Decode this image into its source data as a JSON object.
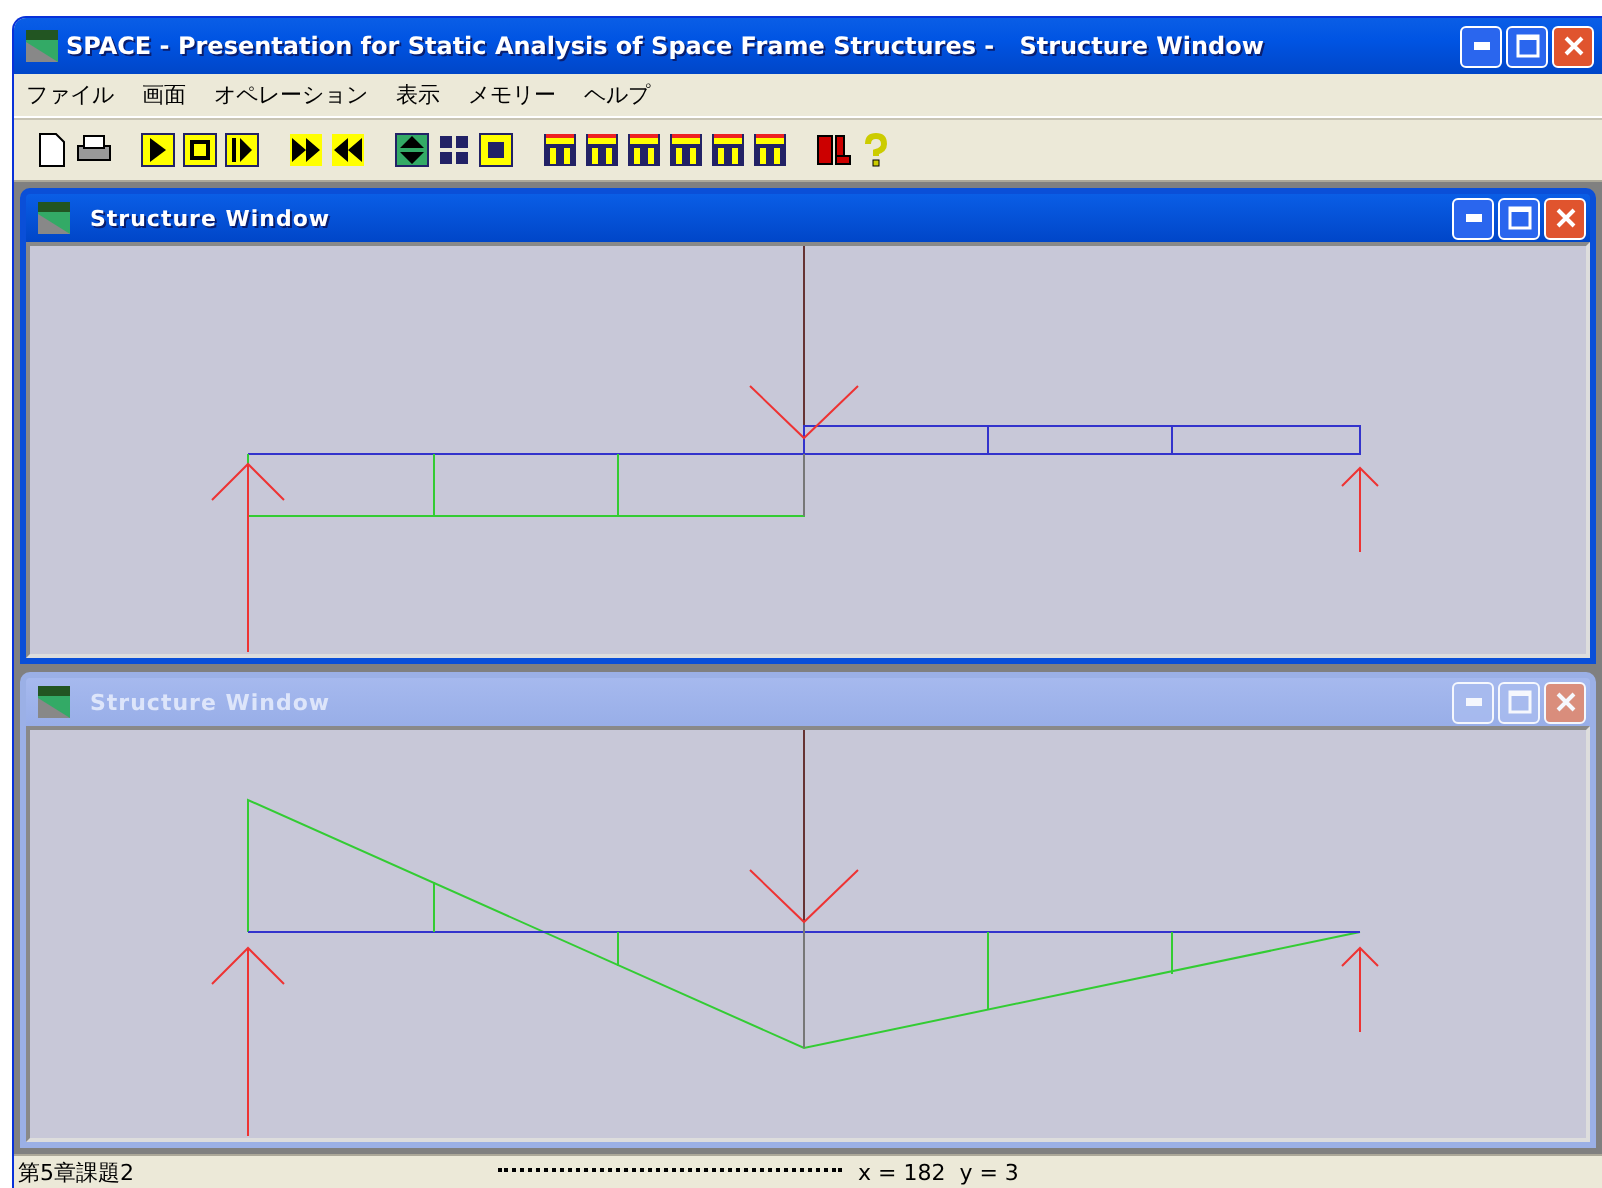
{
  "window": {
    "title": "SPACE - Presentation for Static Analysis of Space Frame Structures -   Structure Window"
  },
  "menu": [
    "ファイル",
    "画面",
    "オペレーション",
    "表示",
    "メモリー",
    "ヘルプ"
  ],
  "children": [
    {
      "title": "Structure Window",
      "active": true,
      "kind": "structure"
    },
    {
      "title": "Structure Window",
      "active": false,
      "kind": "moment"
    }
  ],
  "status_bar": {
    "file": "第5章課題2",
    "coords": "x = 182  y = 3"
  }
}
